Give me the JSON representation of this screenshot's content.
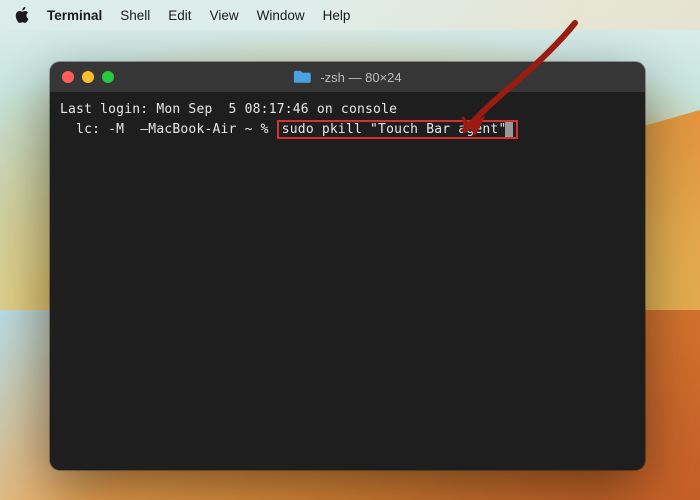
{
  "menubar": {
    "items": [
      "Terminal",
      "Shell",
      "Edit",
      "View",
      "Window",
      "Help"
    ]
  },
  "window": {
    "title": "-zsh — 80×24"
  },
  "terminal": {
    "line1": "Last login: Mon Sep  5 08:17:46 on console",
    "line2_prefix": "  lc: -M  —MacBook-Air ~ % ",
    "command": "sudo pkill \"Touch Bar agent\""
  }
}
